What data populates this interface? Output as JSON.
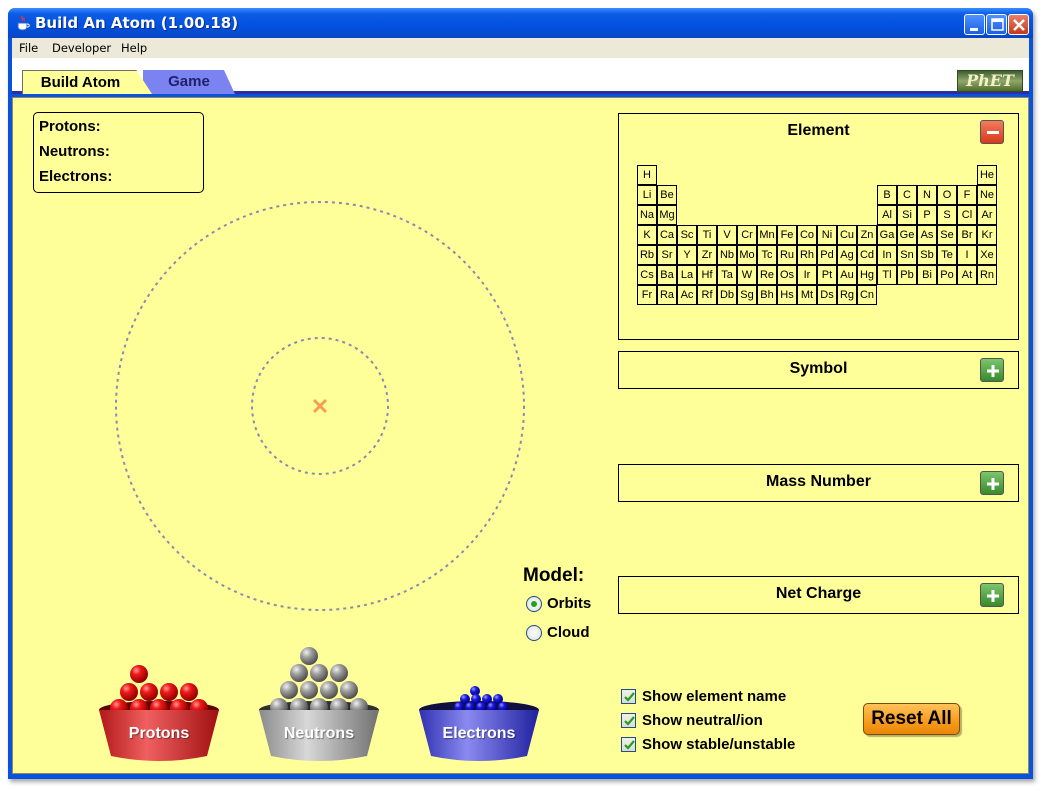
{
  "window": {
    "title": "Build An Atom (1.00.18)"
  },
  "menu": {
    "file": "File",
    "developer": "Developer",
    "help": "Help"
  },
  "tabs": {
    "build_atom": "Build Atom",
    "game": "Game"
  },
  "logo": "PhET",
  "counts": {
    "protons": "Protons:",
    "neutrons": "Neutrons:",
    "electrons": "Electrons:"
  },
  "model": {
    "label": "Model:",
    "orbits": "Orbits",
    "cloud": "Cloud",
    "selected": "Orbits"
  },
  "buckets": {
    "protons": "Protons",
    "neutrons": "Neutrons",
    "electrons": "Electrons"
  },
  "panels": {
    "element": "Element",
    "symbol": "Symbol",
    "mass_number": "Mass Number",
    "net_charge": "Net Charge"
  },
  "periodic_table": [
    [
      "H",
      "",
      "",
      "",
      "",
      "",
      "",
      "",
      "",
      "",
      "",
      "",
      "",
      "",
      "",
      "",
      "",
      "He"
    ],
    [
      "Li",
      "Be",
      "",
      "",
      "",
      "",
      "",
      "",
      "",
      "",
      "",
      "",
      "B",
      "C",
      "N",
      "O",
      "F",
      "Ne"
    ],
    [
      "Na",
      "Mg",
      "",
      "",
      "",
      "",
      "",
      "",
      "",
      "",
      "",
      "",
      "Al",
      "Si",
      "P",
      "S",
      "Cl",
      "Ar"
    ],
    [
      "K",
      "Ca",
      "Sc",
      "Ti",
      "V",
      "Cr",
      "Mn",
      "Fe",
      "Co",
      "Ni",
      "Cu",
      "Zn",
      "Ga",
      "Ge",
      "As",
      "Se",
      "Br",
      "Kr"
    ],
    [
      "Rb",
      "Sr",
      "Y",
      "Zr",
      "Nb",
      "Mo",
      "Tc",
      "Ru",
      "Rh",
      "Pd",
      "Ag",
      "Cd",
      "In",
      "Sn",
      "Sb",
      "Te",
      "I",
      "Xe"
    ],
    [
      "Cs",
      "Ba",
      "La",
      "Hf",
      "Ta",
      "W",
      "Re",
      "Os",
      "Ir",
      "Pt",
      "Au",
      "Hg",
      "Tl",
      "Pb",
      "Bi",
      "Po",
      "At",
      "Rn"
    ],
    [
      "Fr",
      "Ra",
      "Ac",
      "Rf",
      "Db",
      "Sg",
      "Bh",
      "Hs",
      "Mt",
      "Ds",
      "Rg",
      "Cn",
      "",
      "",
      "",
      "",
      "",
      ""
    ]
  ],
  "options": {
    "show_element_name": "Show element name",
    "show_neutral_ion": "Show neutral/ion",
    "show_stable_unstable": "Show stable/unstable",
    "show_element_name_checked": true,
    "show_neutral_ion_checked": true,
    "show_stable_unstable_checked": true
  },
  "reset_all": "Reset All",
  "colors": {
    "background": "#ffff99",
    "proton": "#e01010",
    "neutron": "#9a9a9a",
    "electron": "#1a1adf",
    "nucleus_marker": "#f0a050",
    "orbit": "#8a8ab0"
  },
  "icons": {
    "app": "java-cup-icon",
    "minimize": "minimize-icon",
    "maximize": "maximize-icon",
    "close": "close-icon",
    "element_collapse": "minus-icon",
    "expand": "plus-icon"
  }
}
